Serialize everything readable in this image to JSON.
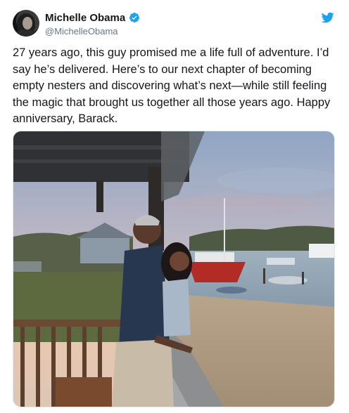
{
  "author": {
    "display_name": "Michelle Obama",
    "handle": "@MichelleObama",
    "verified": true,
    "avatar_icon": "profile-photo"
  },
  "brand": {
    "icon": "twitter-bird-icon",
    "color": "#1da1f2"
  },
  "tweet": {
    "text": "27 years ago, this guy promised me a life full of adventure. I’d say he’s delivered. Here’s to our next chapter of becoming empty nesters and discovering what’s next—while still feeling the magic that brought us together all those years ago. Happy anniversary, Barack."
  },
  "media": {
    "type": "photo",
    "icon": "photo"
  },
  "colors": {
    "verified_badge": "#1da1f2",
    "handle_text": "#657786",
    "body_text": "#14171a"
  }
}
